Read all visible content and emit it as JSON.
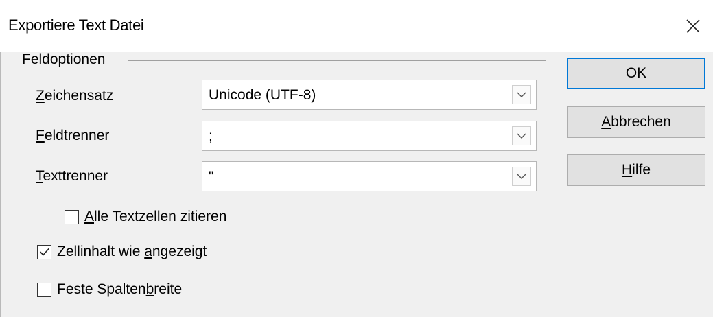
{
  "window": {
    "title": "Exportiere Text Datei",
    "close_icon": "close-icon"
  },
  "field_options": {
    "group_label": "Feldoptionen",
    "charset": {
      "label_key": "Z",
      "label_rest": "eichensatz",
      "value": "Unicode (UTF-8)"
    },
    "field_separator": {
      "label_key": "F",
      "label_rest": "eldtrenner",
      "value": ";"
    },
    "text_separator": {
      "label_key": "T",
      "label_rest": "exttrenner",
      "value": "\""
    },
    "quote_all": {
      "label_key": "A",
      "label_rest": "lle Textzellen zitieren",
      "checked": false
    },
    "as_shown": {
      "label_pre": "Zellinhalt wie ",
      "label_key": "a",
      "label_rest": "ngezeigt",
      "checked": true
    },
    "fixed_width": {
      "label_pre": "Feste Spalten",
      "label_key": "b",
      "label_rest": "reite",
      "checked": false
    }
  },
  "buttons": {
    "ok": "OK",
    "cancel_key": "A",
    "cancel_rest": "bbrechen",
    "help_key": "H",
    "help_rest": "ilfe"
  },
  "colors": {
    "default_button_border": "#0078d7"
  }
}
